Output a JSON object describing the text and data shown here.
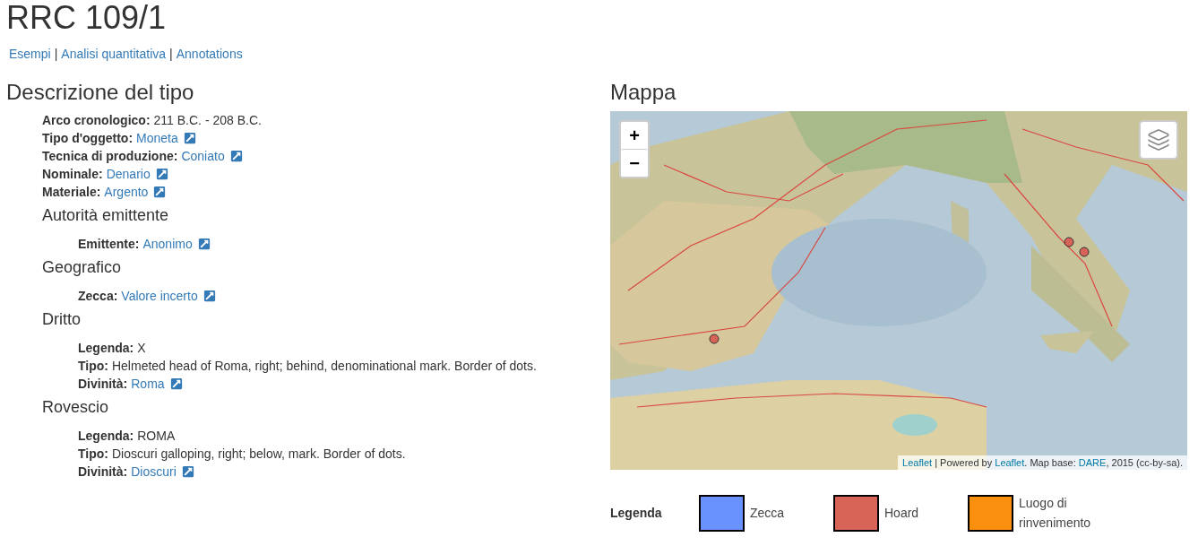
{
  "title": "RRC 109/1",
  "nav": [
    {
      "label": "Esempi"
    },
    {
      "label": "Analisi quantitativa"
    },
    {
      "label": "Annotations"
    }
  ],
  "nav_separator": "|",
  "description": {
    "title": "Descrizione del tipo",
    "fields": [
      {
        "label": "Arco cronologico:",
        "value": "211 B.C. - 208 B.C.",
        "link": false
      },
      {
        "label": "Tipo d'oggetto:",
        "value": "Moneta",
        "link": true
      },
      {
        "label": "Tecnica di produzione:",
        "value": "Coniato",
        "link": true
      },
      {
        "label": "Nominale:",
        "value": "Denario",
        "link": true
      },
      {
        "label": "Materiale:",
        "value": "Argento",
        "link": true
      }
    ],
    "sections": [
      {
        "title": "Autorità emittente",
        "fields": [
          {
            "label": "Emittente:",
            "value": "Anonimo",
            "link": true
          }
        ]
      },
      {
        "title": "Geografico",
        "fields": [
          {
            "label": "Zecca:",
            "value": "Valore incerto",
            "link": true
          }
        ]
      },
      {
        "title": "Dritto",
        "fields": [
          {
            "label": "Legenda:",
            "value": "X",
            "link": false
          },
          {
            "label": "Tipo:",
            "value": "Helmeted head of Roma, right; behind, denominational mark. Border of dots.",
            "link": false
          },
          {
            "label": "Divinità:",
            "value": "Roma",
            "link": true
          }
        ]
      },
      {
        "title": "Rovescio",
        "fields": [
          {
            "label": "Legenda:",
            "value": "ROMA",
            "link": false
          },
          {
            "label": "Tipo:",
            "value": "Dioscuri galloping, right; below, mark. Border of dots.",
            "link": false
          },
          {
            "label": "Divinità:",
            "value": "Dioscuri",
            "link": true
          }
        ]
      }
    ]
  },
  "map": {
    "title": "Mappa",
    "zoom_in": "+",
    "zoom_out": "−",
    "attribution": [
      {
        "text": "Leaflet",
        "link": true
      },
      {
        "text": " | Powered by ",
        "link": false
      },
      {
        "text": "Leaflet",
        "link": true
      },
      {
        "text": ". Map base: ",
        "link": false
      },
      {
        "text": "DARE",
        "link": true
      },
      {
        "text": ", 2015 (cc-by-sa).",
        "link": false
      }
    ]
  },
  "legend": {
    "label": "Legenda",
    "items": [
      {
        "label": "Zecca",
        "color": "#6992ff"
      },
      {
        "label": "Hoard",
        "color": "#d86458"
      },
      {
        "label": "Luogo di rinvenimento",
        "color": "#f98f0c"
      }
    ]
  }
}
